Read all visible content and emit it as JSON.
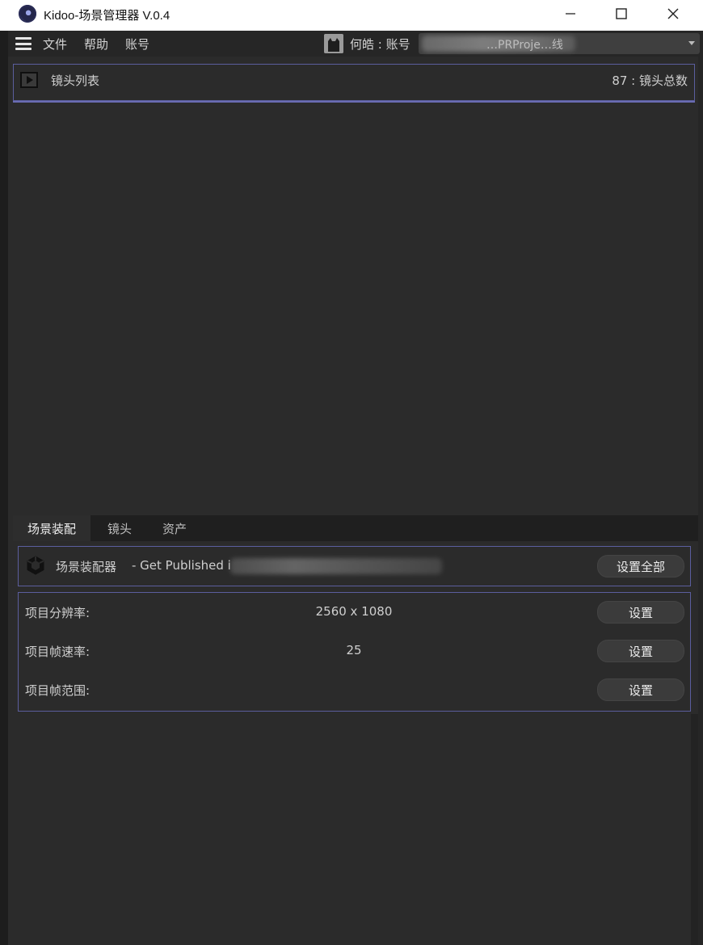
{
  "window": {
    "title": "Kidoo-场景管理器 V.0.4"
  },
  "menu": {
    "items": [
      "文件",
      "帮助",
      "账号"
    ],
    "user_label": "何皓 : 账号",
    "project_select_text": "…PRProje…线"
  },
  "shot_list": {
    "title": "镜头列表",
    "count_label": "87 : 镜头总数"
  },
  "tabs": [
    {
      "label": "场景装配",
      "active": true
    },
    {
      "label": "镜头",
      "active": false
    },
    {
      "label": "资产",
      "active": false
    }
  ],
  "assembler": {
    "title": "场景装配器",
    "path_prefix": "- Get Published i",
    "set_all_label": "设置全部"
  },
  "settings": {
    "rows": [
      {
        "label": "项目分辨率:",
        "value": "2560 x 1080",
        "button": "设置"
      },
      {
        "label": "项目帧速率:",
        "value": "25",
        "button": "设置"
      },
      {
        "label": "项目帧范围:",
        "value": "",
        "button": "设置"
      }
    ]
  },
  "colors": {
    "background": "#2b2b2b",
    "panel_border": "#5b5e9e",
    "titlebar": "#ffffff"
  }
}
